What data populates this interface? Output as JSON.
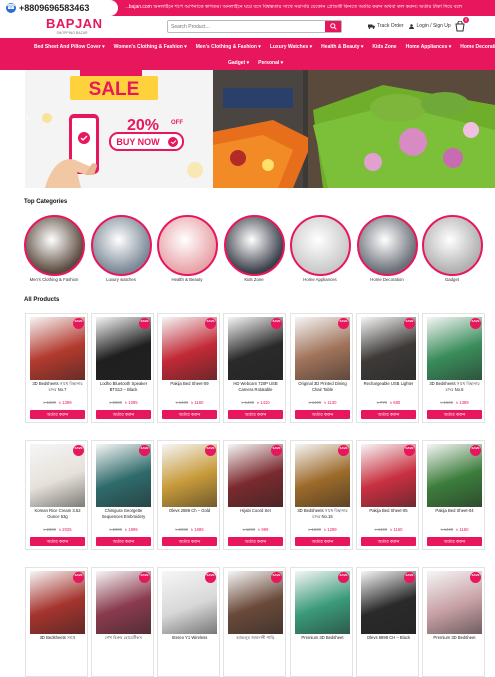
{
  "topbar": {
    "phone": "+8809696583463",
    "ticker": "..bajan.com অনলাইনে শপে আপনাকে স্বাগতম। অনলাইনে ঘরে বসে বিশ্বস্ততার সাথে সরাসরি যেকোন প্রোডাক্ট কিনতে অর্ডার করুন অথবা কল করুন। অর্ডার টাকা দিয়ে বলে"
  },
  "header": {
    "logo": "BAPJAN",
    "logo_tag": "SHOPPING BAZAR",
    "search_placeholder": "Search Product...",
    "track_order": "Track Order",
    "login": "Login / Sign Up",
    "cart_count": "0"
  },
  "nav": {
    "row1": [
      "Bed Sheet And Pillow Cover ▾",
      "Women's Clothing & Fashion ▾",
      "Men's Clothing & Fashion ▾",
      "Luxury Watches ▾",
      "Health & Beauty ▾",
      "Kids Zone",
      "Home Appliances ▾",
      "Home Decoration ▾"
    ],
    "row2": [
      "Gadget ▾",
      "Personal ▾"
    ]
  },
  "banner": {
    "sale": "SALE",
    "off_percent": "20%",
    "off_label": "OFF",
    "buy_now": "BUY NOW"
  },
  "categories": {
    "title": "Top Categories",
    "items": [
      {
        "label": "Men's Clothing & Fashion",
        "color": "#5b4a3f"
      },
      {
        "label": "Luxury watches",
        "color": "#7b8896"
      },
      {
        "label": "Health & Beauty",
        "color": "#e8a3a8"
      },
      {
        "label": "Kids Zone",
        "color": "#3b3f4a"
      },
      {
        "label": "Home Appliances",
        "color": "#c9c9c9"
      },
      {
        "label": "Home Decoration",
        "color": "#6a6f78"
      },
      {
        "label": "Gadget",
        "color": "#b0b0b0"
      }
    ]
  },
  "products": {
    "title": "All Products",
    "discount_label": "SAVE",
    "order_label": "অর্ডার করুন",
    "rows": [
      [
        {
          "name": "3D Bedsheets সাথে বিছানার চাদর No.7",
          "old": "৳ 1600",
          "new": "৳ 1399",
          "color": "#b33a2e"
        },
        {
          "name": "Lodho Bluetooth Speaker BTS12 – Black",
          "old": "৳ 2000",
          "new": "৳ 1085",
          "color": "#1f1f1f"
        },
        {
          "name": "Pakija Bed Sheet-09",
          "old": "৳ 1400",
          "new": "৳ 1160",
          "color": "#c22a36"
        },
        {
          "name": "HD Webcam 720P USB Camera Rotatable",
          "old": "৳ 1400",
          "new": "৳ 1410",
          "color": "#2a2a2a"
        },
        {
          "name": "Original 3D Printed Dining Chair Table",
          "old": "৳ 1400",
          "new": "৳ 1130",
          "color": "#a0735a"
        },
        {
          "name": "Rechargeable USB Lighter",
          "old": "৳ 770",
          "new": "৳ 680",
          "color": "#3d3a38"
        },
        {
          "name": "3D Bedsheets সাথে বিছানার চাদর No.6",
          "old": "৳ 1600",
          "new": "৳ 1399",
          "color": "#3a8d5b"
        }
      ],
      [
        {
          "name": "Korean Rice Cream 3.52 Ounce 53g",
          "old": "৳ 2300",
          "new": "৳ 2025",
          "color": "#e6e1da"
        },
        {
          "name": "Chinigura Georgette Sequences Embroidery",
          "old": "৳ 2300",
          "new": "৳ 1999",
          "color": "#2f6b6c"
        },
        {
          "name": "Olevs 2889 Ch – Gold",
          "old": "৳ 2000",
          "new": "৳ 1695",
          "color": "#c79a3a"
        },
        {
          "name": "Hijabi Coord Set",
          "old": "৳ 1200",
          "new": "৳ 999",
          "color": "#7a2a2e"
        },
        {
          "name": "3D Bedsheets সাথে বিছানার চাদর No.15",
          "old": "৳ 1600",
          "new": "৳ 1299",
          "color": "#9c6a2a"
        },
        {
          "name": "Pakija Bed Sheet-05",
          "old": "৳ 1400",
          "new": "৳ 1160",
          "color": "#c93040"
        },
        {
          "name": "Pakija Bed Sheet-04",
          "old": "৳ 1400",
          "new": "৳ 1160",
          "color": "#3c7d3b"
        }
      ],
      [
        {
          "name": "3D Bedsheets সাথে",
          "old": "",
          "new": "",
          "color": "#a5342e"
        },
        {
          "name": "শেখ বিক্রয় হোমেটিকস",
          "old": "",
          "new": "",
          "color": "#8a3b4e"
        },
        {
          "name": "Stereo Y1 Wireless",
          "old": "",
          "new": "",
          "color": "#d8d8d8"
        },
        {
          "name": "হ্যান্ডলুম জামদানী শাড়ি",
          "old": "",
          "new": "",
          "color": "#6a4a3a"
        },
        {
          "name": "Premium 3D Bedsheet",
          "old": "",
          "new": "",
          "color": "#3a9a7a"
        },
        {
          "name": "Olevs 6898 CH – Black",
          "old": "",
          "new": "",
          "color": "#2a2a2a"
        },
        {
          "name": "Premium 3D Bedsheet",
          "old": "",
          "new": "",
          "color": "#c7a0a5"
        }
      ]
    ]
  }
}
